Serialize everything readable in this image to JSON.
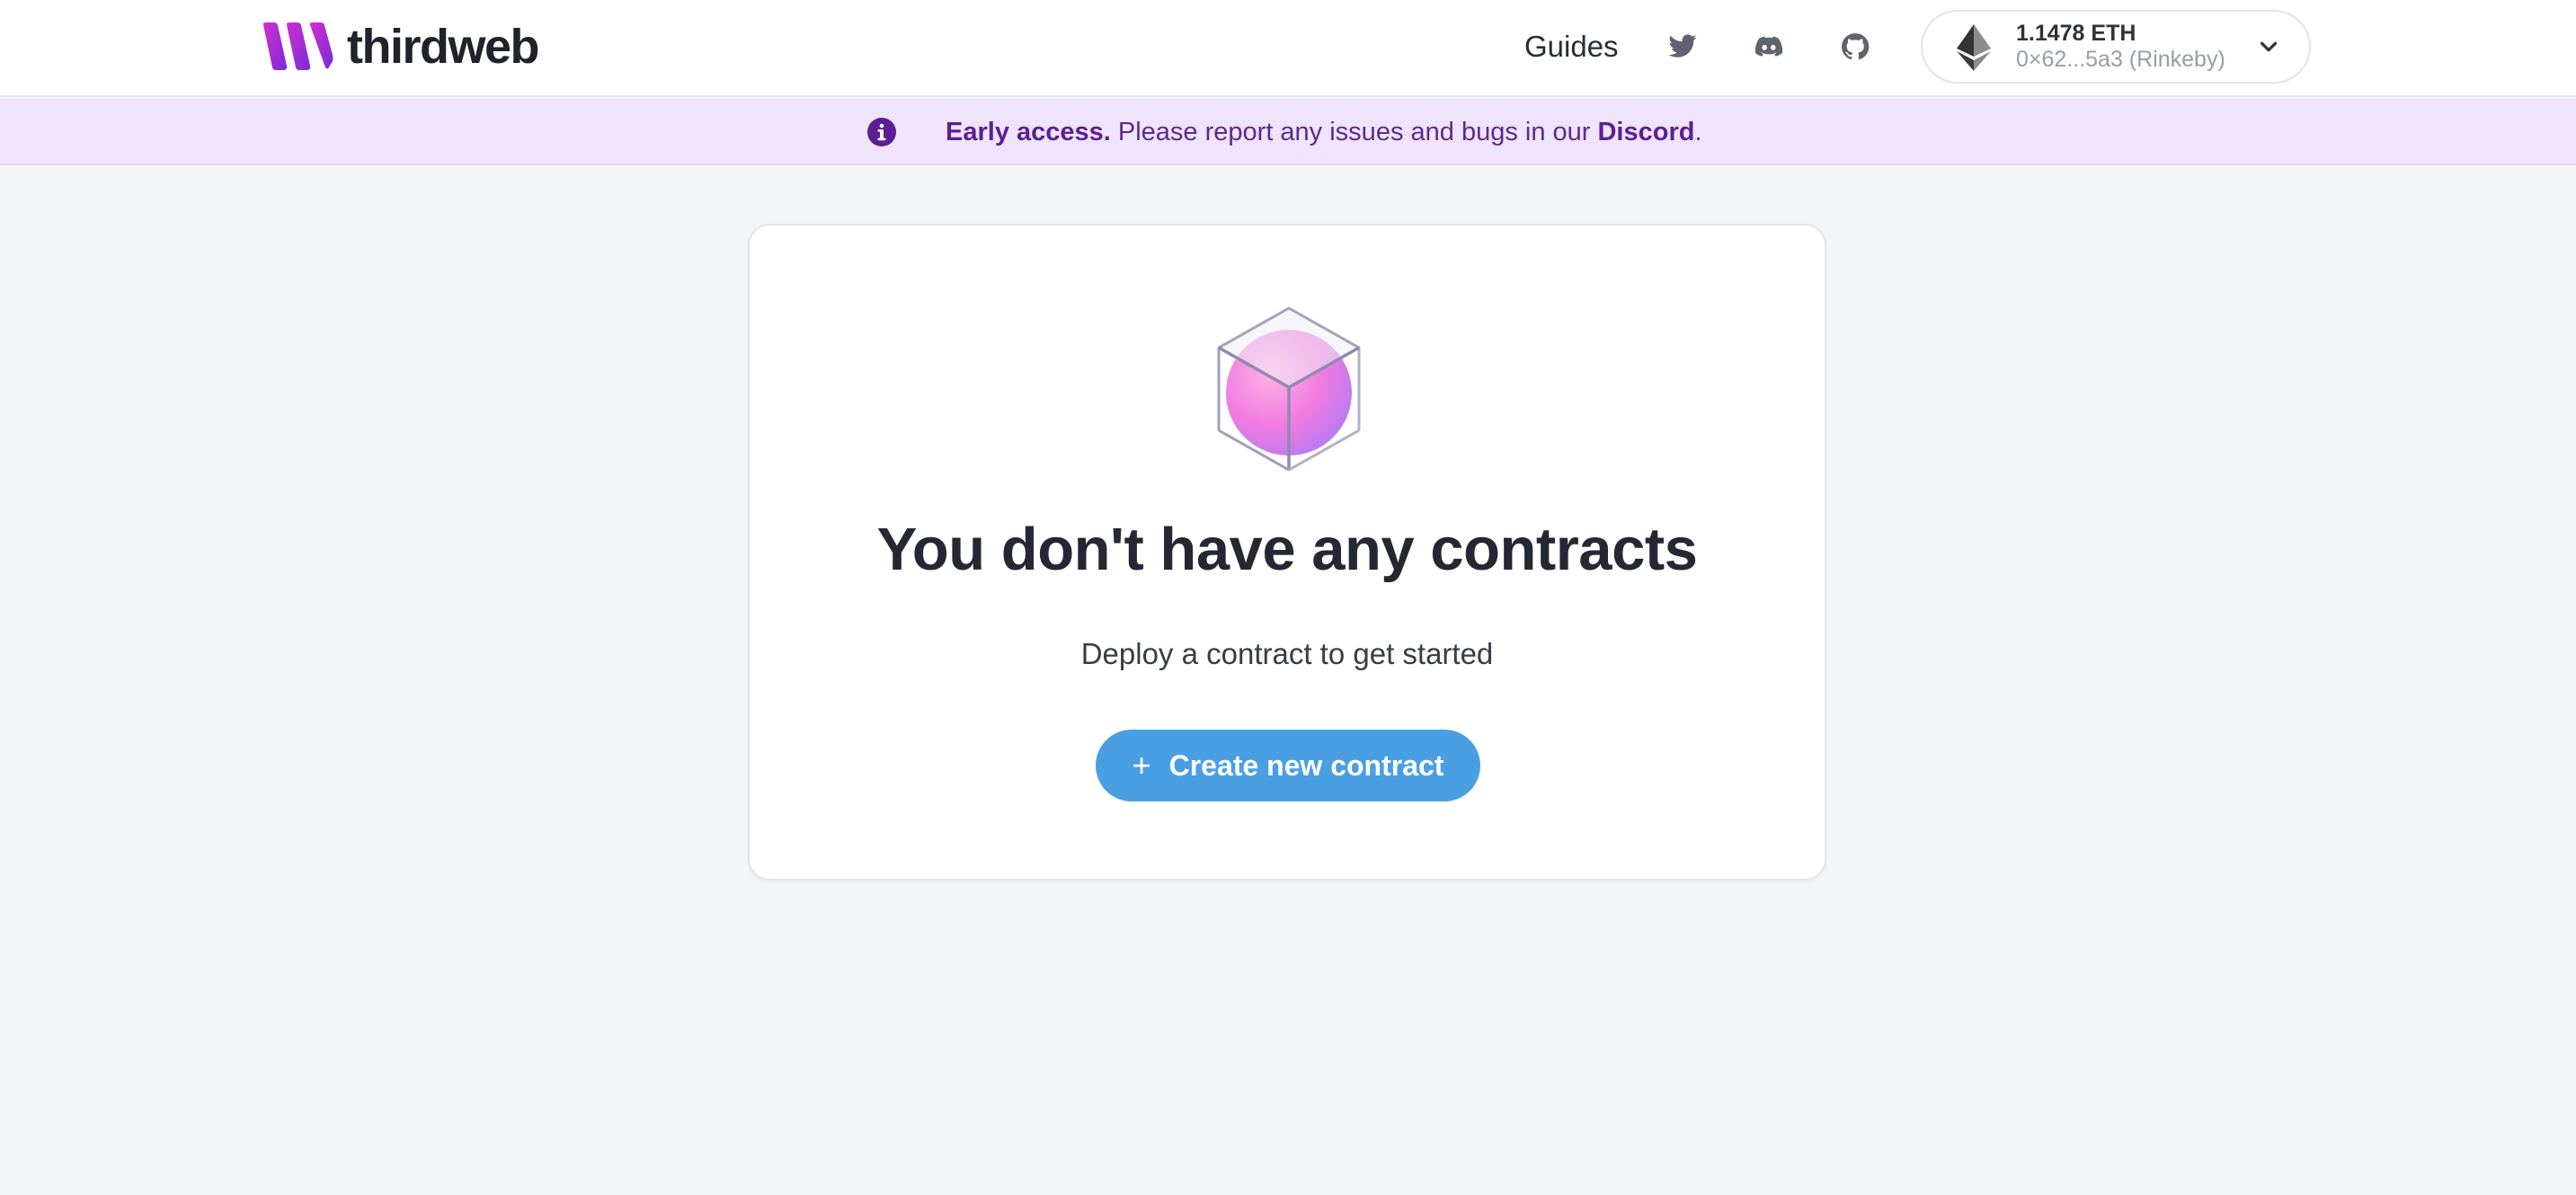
{
  "header": {
    "brand": "thirdweb",
    "nav": {
      "guides_label": "Guides",
      "icons": [
        "twitter-icon",
        "discord-icon",
        "github-icon"
      ]
    },
    "wallet": {
      "balance": "1.1478 ETH",
      "address": "0×62...5a3 (Rinkeby)",
      "network_icon": "ethereum-icon",
      "dropdown_icon": "chevron-down-icon"
    }
  },
  "banner": {
    "icon": "info-icon",
    "strong": "Early access.",
    "text": " Please report any issues and bugs in our ",
    "link": "Discord",
    "suffix": "."
  },
  "empty_state": {
    "illustration": "cube-icon",
    "title": "You don't have any contracts",
    "subtitle": "Deploy a contract to get started",
    "button_icon": "+",
    "button_label": "Create new contract"
  },
  "colors": {
    "brand_gradient": [
      "#c624c8",
      "#7a2bd9"
    ],
    "banner_bg": "#efe4fb",
    "banner_text": "#5b1f93",
    "primary_button": "#4a9fe2",
    "page_bg": "#f4f5f7"
  }
}
